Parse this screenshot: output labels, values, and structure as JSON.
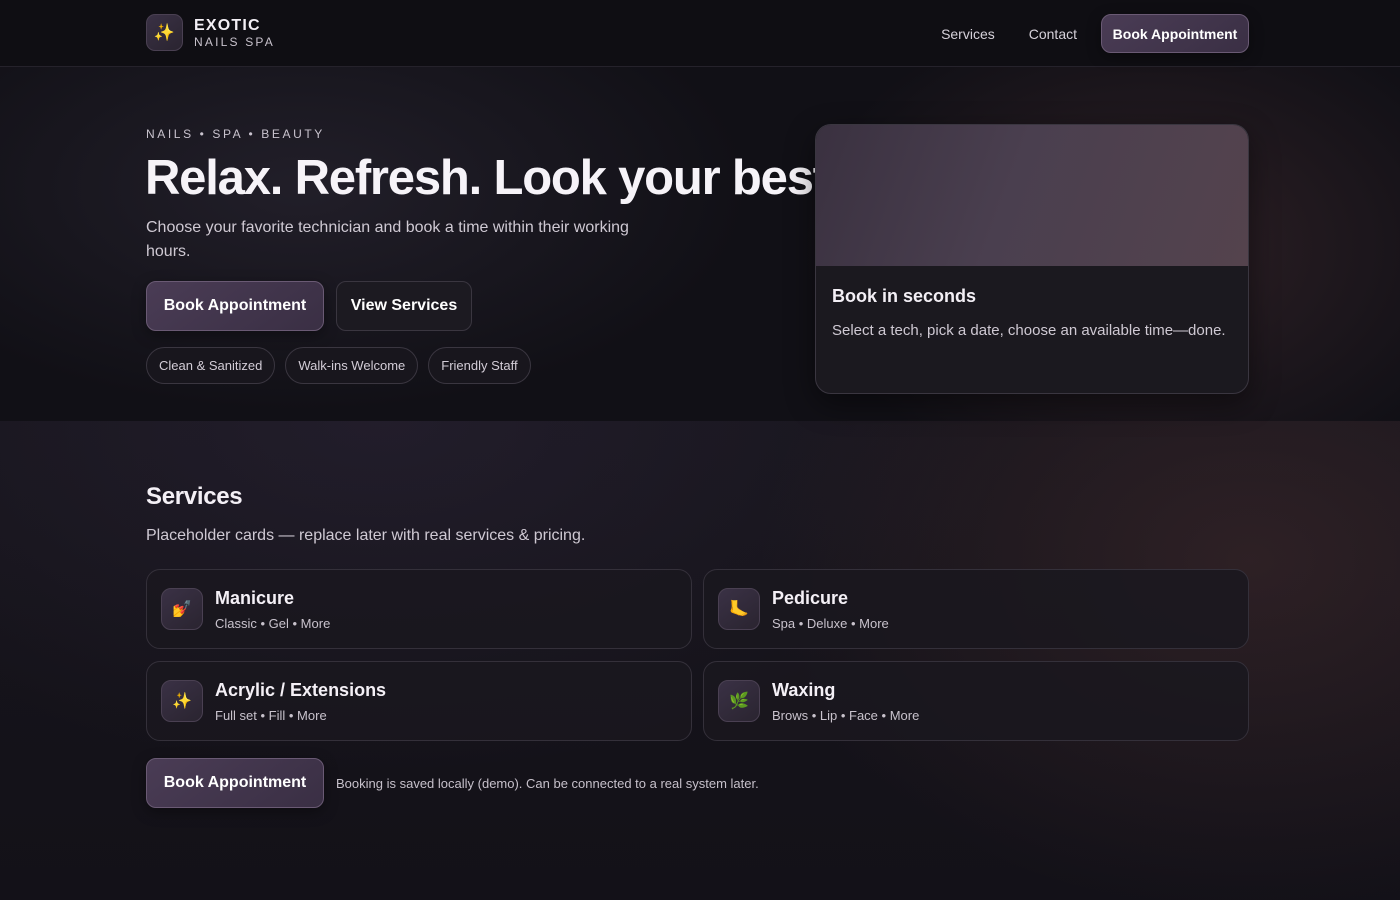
{
  "brand": {
    "icon": "sparkles-icon",
    "name": "EXOTIC",
    "tagline": "NAILS SPA"
  },
  "nav": {
    "links": [
      "Services",
      "Contact"
    ],
    "cta": "Book Appointment"
  },
  "hero": {
    "eyebrow": "NAILS • SPA • BEAUTY",
    "title": "Relax. Refresh. Look your best.",
    "subtitle": "Choose your favorite technician and book a time within their working hours.",
    "primary_button": "Book Appointment",
    "secondary_button": "View Services",
    "chips": [
      "Clean & Sanitized",
      "Walk-ins Welcome",
      "Friendly Staff"
    ],
    "card": {
      "title": "Book in seconds",
      "text": "Select a tech, pick a date, choose an available time—done."
    }
  },
  "services": {
    "title": "Services",
    "subtitle": "Placeholder cards — replace later with real services & pricing.",
    "items": [
      {
        "icon": "nail-polish-icon",
        "glyph": "💅",
        "name": "Manicure",
        "desc": "Classic • Gel • More"
      },
      {
        "icon": "foot-icon",
        "glyph": "🦶",
        "name": "Pedicure",
        "desc": "Spa • Deluxe • More"
      },
      {
        "icon": "sparkles-icon",
        "glyph": "✨",
        "name": "Acrylic / Extensions",
        "desc": "Full set • Fill • More"
      },
      {
        "icon": "herb-icon",
        "glyph": "🌿",
        "name": "Waxing",
        "desc": "Brows • Lip • Face • More"
      }
    ],
    "footer_button": "Book Appointment",
    "footer_note": "Booking is saved locally (demo). Can be connected to a real system later."
  },
  "colors": {
    "background": "#15131a",
    "topbar": "#0f0e13",
    "accent": "#4a3c55",
    "text": "#f6f3f8"
  }
}
